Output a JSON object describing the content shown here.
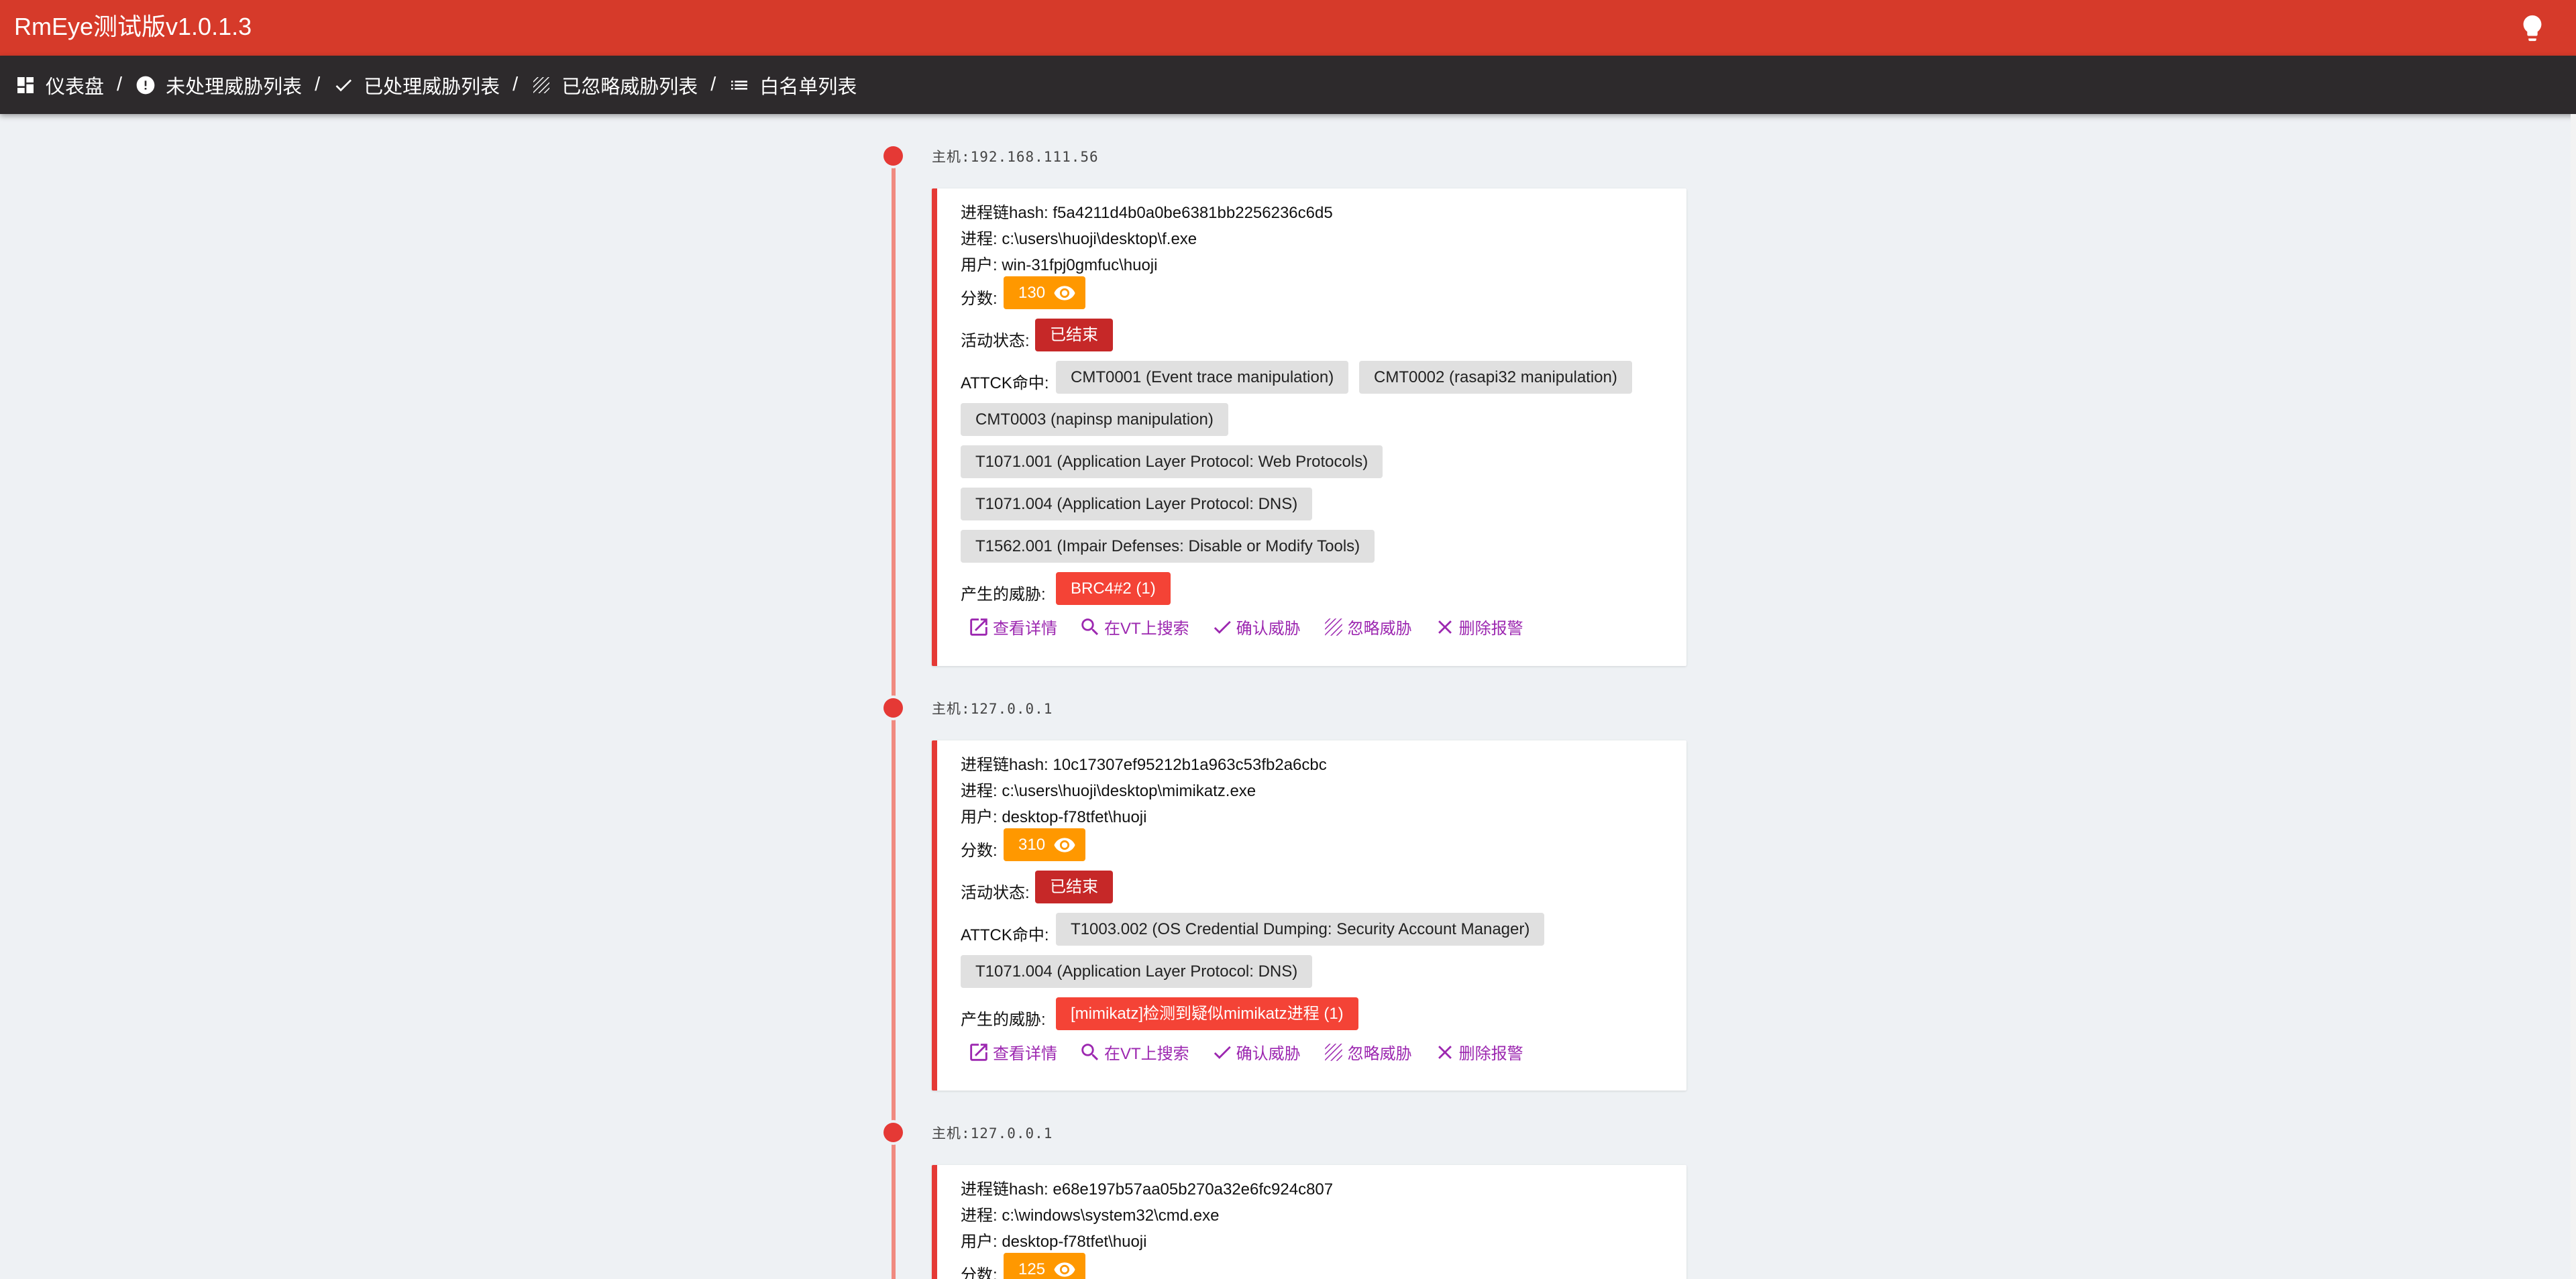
{
  "app": {
    "title": "RmEye测试版v1.0.1.3"
  },
  "breadcrumbs": [
    {
      "label": "仪表盘",
      "icon": "dashboard-icon"
    },
    {
      "label": "未处理威胁列表",
      "icon": "alert-circle-icon"
    },
    {
      "label": "已处理威胁列表",
      "icon": "check-icon"
    },
    {
      "label": "已忽略威胁列表",
      "icon": "hatch-icon"
    },
    {
      "label": "白名单列表",
      "icon": "list-icon"
    }
  ],
  "separator": "/",
  "actions": {
    "details": "查看详情",
    "vt_search": "在VT上搜索",
    "confirm": "确认威胁",
    "ignore": "忽略威胁",
    "delete": "删除报警"
  },
  "entries": [
    {
      "host": "主机:192.168.111.56",
      "chain_hash": "进程链hash: f5a4211d4b0a0be6381bb2256236c6d5",
      "process": "进程: c:\\users\\huoji\\desktop\\f.exe",
      "user": "用户: win-31fpj0gmfuc\\huoji",
      "score_label": "分数:",
      "score": "130",
      "status_label": "活动状态:",
      "status": "已结束",
      "attck_label": "ATTCK命中:",
      "attck": [
        "CMT0001 (Event trace manipulation)",
        "CMT0002 (rasapi32 manipulation)",
        "CMT0003 (napinsp manipulation)",
        "T1071.001 (Application Layer Protocol: Web Protocols)",
        "T1071.004 (Application Layer Protocol: DNS)",
        "T1562.001 (Impair Defenses: Disable or Modify Tools)"
      ],
      "threat_label": "产生的威胁:",
      "threat": "BRC4#2 (1)"
    },
    {
      "host": "主机:127.0.0.1",
      "chain_hash": "进程链hash: 10c17307ef95212b1a963c53fb2a6cbc",
      "process": "进程: c:\\users\\huoji\\desktop\\mimikatz.exe",
      "user": "用户: desktop-f78tfet\\huoji",
      "score_label": "分数:",
      "score": "310",
      "status_label": "活动状态:",
      "status": "已结束",
      "attck_label": "ATTCK命中:",
      "attck": [
        "T1003.002 (OS Credential Dumping: Security Account Manager)",
        "T1071.004 (Application Layer Protocol: DNS)"
      ],
      "threat_label": "产生的威胁:",
      "threat": "[mimikatz]检测到疑似mimikatz进程 (1)"
    },
    {
      "host": "主机:127.0.0.1",
      "chain_hash": "进程链hash: e68e197b57aa05b270a32e6fc924c807",
      "process": "进程: c:\\windows\\system32\\cmd.exe",
      "user": "用户: desktop-f78tfet\\huoji",
      "score_label": "分数:",
      "score": "125"
    }
  ],
  "colors": {
    "topbar": "#d63a2a",
    "crumbbar": "#2d2a2c",
    "accent_red": "#e53935",
    "score_orange": "#ff9800",
    "status_darkred": "#c62828",
    "threat_red": "#f44336",
    "action_purple": "#9c27b0"
  }
}
